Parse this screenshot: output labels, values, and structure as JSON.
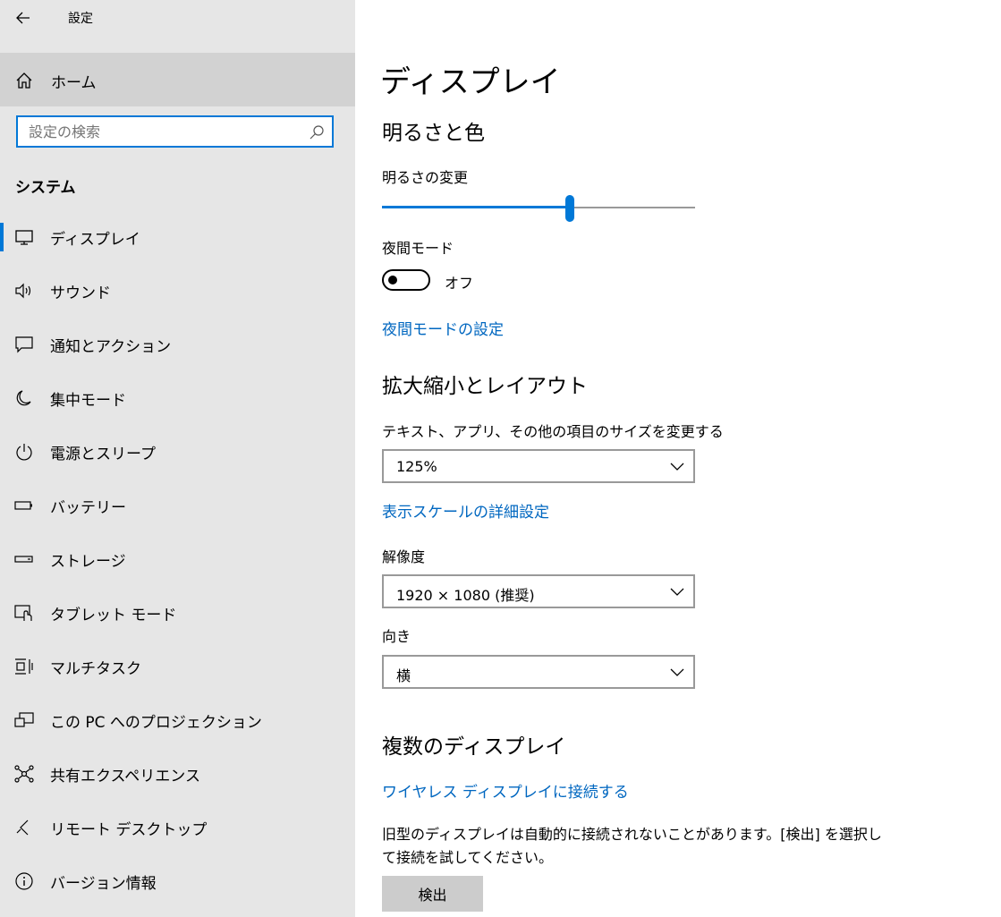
{
  "window": {
    "title": "設定"
  },
  "sidebar": {
    "home_label": "ホーム",
    "search_placeholder": "設定の検索",
    "section_label": "システム",
    "items": [
      {
        "label": "ディスプレイ",
        "icon": "monitor-icon",
        "active": true
      },
      {
        "label": "サウンド",
        "icon": "speaker-icon"
      },
      {
        "label": "通知とアクション",
        "icon": "notification-icon"
      },
      {
        "label": "集中モード",
        "icon": "moon-icon"
      },
      {
        "label": "電源とスリープ",
        "icon": "power-icon"
      },
      {
        "label": "バッテリー",
        "icon": "battery-icon"
      },
      {
        "label": "ストレージ",
        "icon": "storage-icon"
      },
      {
        "label": "タブレット モード",
        "icon": "tablet-mode-icon"
      },
      {
        "label": "マルチタスク",
        "icon": "multitask-icon"
      },
      {
        "label": "この PC へのプロジェクション",
        "icon": "projection-icon"
      },
      {
        "label": "共有エクスペリエンス",
        "icon": "shared-experiences-icon"
      },
      {
        "label": "リモート デスクトップ",
        "icon": "remote-desktop-icon"
      },
      {
        "label": "バージョン情報",
        "icon": "info-icon"
      }
    ]
  },
  "main": {
    "title": "ディスプレイ",
    "brightness_section": "明るさと色",
    "brightness_label": "明るさの変更",
    "brightness_value": 0.6,
    "night_light_label": "夜間モード",
    "night_light_state": "オフ",
    "night_light_link": "夜間モードの設定",
    "scale_section": "拡大縮小とレイアウト",
    "scale_label": "テキスト、アプリ、その他の項目のサイズを変更する",
    "scale_value": "125%",
    "scale_link": "表示スケールの詳細設定",
    "resolution_label": "解像度",
    "resolution_value": "1920 × 1080 (推奨)",
    "orientation_label": "向き",
    "orientation_value": "横",
    "multi_section": "複数のディスプレイ",
    "wireless_link": "ワイヤレス ディスプレイに接続する",
    "detect_text": "旧型のディスプレイは自動的に接続されないことがあります。[検出] を選択して接続を試してください。",
    "detect_button": "検出"
  },
  "colors": {
    "accent": "#0078d7",
    "link": "#0067c0",
    "sidebar_bg": "#e6e6e6",
    "home_bg": "#d2d2d2"
  }
}
